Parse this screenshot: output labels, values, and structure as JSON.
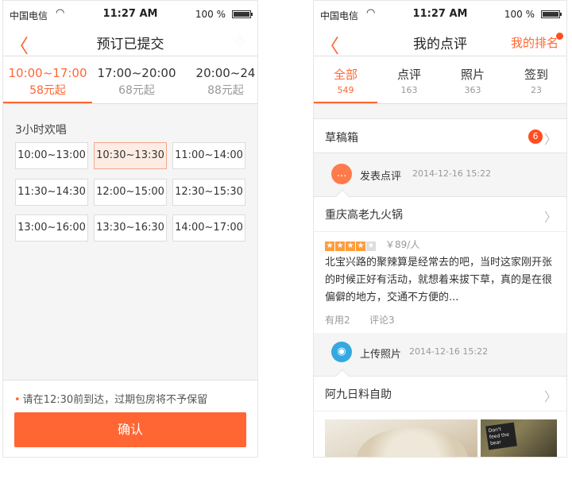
{
  "status_bar": {
    "carrier": "中国电信",
    "time": "11:27 AM",
    "battery": "100 %"
  },
  "left": {
    "nav": {
      "back": "〈",
      "title": "预订已提交",
      "plus": "+"
    },
    "time_slots": [
      {
        "range": "10:00~17:00",
        "price": "58元起",
        "active": true
      },
      {
        "range": "17:00~20:00",
        "price": "68元起",
        "active": false
      },
      {
        "range": "20:00~24",
        "price": "88元起",
        "active": false
      }
    ],
    "section_label": "3小时欢唱",
    "grid": [
      {
        "label": "10:00~13:00",
        "selected": false
      },
      {
        "label": "10:30~13:30",
        "selected": true
      },
      {
        "label": "11:00~14:00",
        "selected": false
      },
      {
        "label": "11:30~14:30",
        "selected": false
      },
      {
        "label": "12:00~15:00",
        "selected": false
      },
      {
        "label": "12:30~15:30",
        "selected": false
      },
      {
        "label": "13:00~16:00",
        "selected": false
      },
      {
        "label": "13:30~16:30",
        "selected": false
      },
      {
        "label": "14:00~17:00",
        "selected": false
      }
    ],
    "notice": "请在12:30前到达，过期包房将不予保留",
    "confirm_label": "确认"
  },
  "right": {
    "nav": {
      "back": "〈",
      "title": "我的点评",
      "rank": "我的排名"
    },
    "tabs": [
      {
        "label": "全部",
        "count": "549",
        "active": true
      },
      {
        "label": "点评",
        "count": "163",
        "active": false
      },
      {
        "label": "照片",
        "count": "363",
        "active": false
      },
      {
        "label": "签到",
        "count": "23",
        "active": false
      }
    ],
    "drafts": {
      "label": "草稿箱",
      "badge": "6"
    },
    "review_event": {
      "label": "发表点评",
      "time": "2014-12-16 15:22"
    },
    "review": {
      "shop": "重庆高老九火锅",
      "rating": 4,
      "rating_max": 5,
      "avg_price": "￥89/人",
      "text": "北宝兴路的聚辣算是经常去的吧，当时这家刚开张的时候正好有活动，就想着来拔下草，真的是在很偏僻的地方，交通不方便的...",
      "useful": "有用2",
      "comments": "评论3"
    },
    "photo_event": {
      "label": "上传照片",
      "time": "2014-12-16 15:22"
    },
    "photo_shop": "阿九日料自助",
    "photo_sign_text": "Don't feed the bear"
  },
  "colors": {
    "accent": "#ff6633",
    "badge": "#ff4e20",
    "photo_icon": "#35a8e0"
  },
  "icons": {
    "chat": "chat-bubble-icon",
    "camera": "camera-icon",
    "wifi": "wifi-icon",
    "battery": "battery-icon"
  }
}
